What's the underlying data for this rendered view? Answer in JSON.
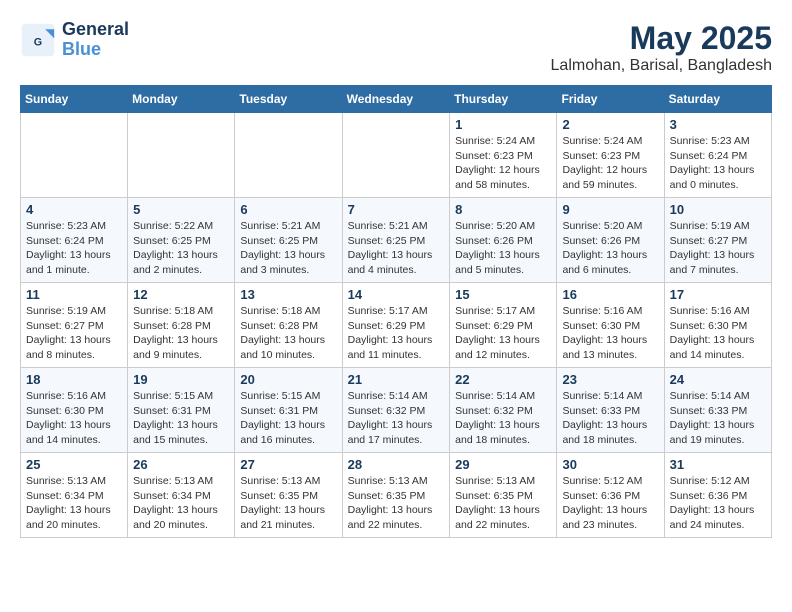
{
  "logo": {
    "text_general": "General",
    "text_blue": "Blue"
  },
  "title": "May 2025",
  "location": "Lalmohan, Barisal, Bangladesh",
  "weekdays": [
    "Sunday",
    "Monday",
    "Tuesday",
    "Wednesday",
    "Thursday",
    "Friday",
    "Saturday"
  ],
  "weeks": [
    [
      {
        "day": "",
        "info": ""
      },
      {
        "day": "",
        "info": ""
      },
      {
        "day": "",
        "info": ""
      },
      {
        "day": "",
        "info": ""
      },
      {
        "day": "1",
        "info": "Sunrise: 5:24 AM\nSunset: 6:23 PM\nDaylight: 12 hours\nand 58 minutes."
      },
      {
        "day": "2",
        "info": "Sunrise: 5:24 AM\nSunset: 6:23 PM\nDaylight: 12 hours\nand 59 minutes."
      },
      {
        "day": "3",
        "info": "Sunrise: 5:23 AM\nSunset: 6:24 PM\nDaylight: 13 hours\nand 0 minutes."
      }
    ],
    [
      {
        "day": "4",
        "info": "Sunrise: 5:23 AM\nSunset: 6:24 PM\nDaylight: 13 hours\nand 1 minute."
      },
      {
        "day": "5",
        "info": "Sunrise: 5:22 AM\nSunset: 6:25 PM\nDaylight: 13 hours\nand 2 minutes."
      },
      {
        "day": "6",
        "info": "Sunrise: 5:21 AM\nSunset: 6:25 PM\nDaylight: 13 hours\nand 3 minutes."
      },
      {
        "day": "7",
        "info": "Sunrise: 5:21 AM\nSunset: 6:25 PM\nDaylight: 13 hours\nand 4 minutes."
      },
      {
        "day": "8",
        "info": "Sunrise: 5:20 AM\nSunset: 6:26 PM\nDaylight: 13 hours\nand 5 minutes."
      },
      {
        "day": "9",
        "info": "Sunrise: 5:20 AM\nSunset: 6:26 PM\nDaylight: 13 hours\nand 6 minutes."
      },
      {
        "day": "10",
        "info": "Sunrise: 5:19 AM\nSunset: 6:27 PM\nDaylight: 13 hours\nand 7 minutes."
      }
    ],
    [
      {
        "day": "11",
        "info": "Sunrise: 5:19 AM\nSunset: 6:27 PM\nDaylight: 13 hours\nand 8 minutes."
      },
      {
        "day": "12",
        "info": "Sunrise: 5:18 AM\nSunset: 6:28 PM\nDaylight: 13 hours\nand 9 minutes."
      },
      {
        "day": "13",
        "info": "Sunrise: 5:18 AM\nSunset: 6:28 PM\nDaylight: 13 hours\nand 10 minutes."
      },
      {
        "day": "14",
        "info": "Sunrise: 5:17 AM\nSunset: 6:29 PM\nDaylight: 13 hours\nand 11 minutes."
      },
      {
        "day": "15",
        "info": "Sunrise: 5:17 AM\nSunset: 6:29 PM\nDaylight: 13 hours\nand 12 minutes."
      },
      {
        "day": "16",
        "info": "Sunrise: 5:16 AM\nSunset: 6:30 PM\nDaylight: 13 hours\nand 13 minutes."
      },
      {
        "day": "17",
        "info": "Sunrise: 5:16 AM\nSunset: 6:30 PM\nDaylight: 13 hours\nand 14 minutes."
      }
    ],
    [
      {
        "day": "18",
        "info": "Sunrise: 5:16 AM\nSunset: 6:30 PM\nDaylight: 13 hours\nand 14 minutes."
      },
      {
        "day": "19",
        "info": "Sunrise: 5:15 AM\nSunset: 6:31 PM\nDaylight: 13 hours\nand 15 minutes."
      },
      {
        "day": "20",
        "info": "Sunrise: 5:15 AM\nSunset: 6:31 PM\nDaylight: 13 hours\nand 16 minutes."
      },
      {
        "day": "21",
        "info": "Sunrise: 5:14 AM\nSunset: 6:32 PM\nDaylight: 13 hours\nand 17 minutes."
      },
      {
        "day": "22",
        "info": "Sunrise: 5:14 AM\nSunset: 6:32 PM\nDaylight: 13 hours\nand 18 minutes."
      },
      {
        "day": "23",
        "info": "Sunrise: 5:14 AM\nSunset: 6:33 PM\nDaylight: 13 hours\nand 18 minutes."
      },
      {
        "day": "24",
        "info": "Sunrise: 5:14 AM\nSunset: 6:33 PM\nDaylight: 13 hours\nand 19 minutes."
      }
    ],
    [
      {
        "day": "25",
        "info": "Sunrise: 5:13 AM\nSunset: 6:34 PM\nDaylight: 13 hours\nand 20 minutes."
      },
      {
        "day": "26",
        "info": "Sunrise: 5:13 AM\nSunset: 6:34 PM\nDaylight: 13 hours\nand 20 minutes."
      },
      {
        "day": "27",
        "info": "Sunrise: 5:13 AM\nSunset: 6:35 PM\nDaylight: 13 hours\nand 21 minutes."
      },
      {
        "day": "28",
        "info": "Sunrise: 5:13 AM\nSunset: 6:35 PM\nDaylight: 13 hours\nand 22 minutes."
      },
      {
        "day": "29",
        "info": "Sunrise: 5:13 AM\nSunset: 6:35 PM\nDaylight: 13 hours\nand 22 minutes."
      },
      {
        "day": "30",
        "info": "Sunrise: 5:12 AM\nSunset: 6:36 PM\nDaylight: 13 hours\nand 23 minutes."
      },
      {
        "day": "31",
        "info": "Sunrise: 5:12 AM\nSunset: 6:36 PM\nDaylight: 13 hours\nand 24 minutes."
      }
    ]
  ]
}
